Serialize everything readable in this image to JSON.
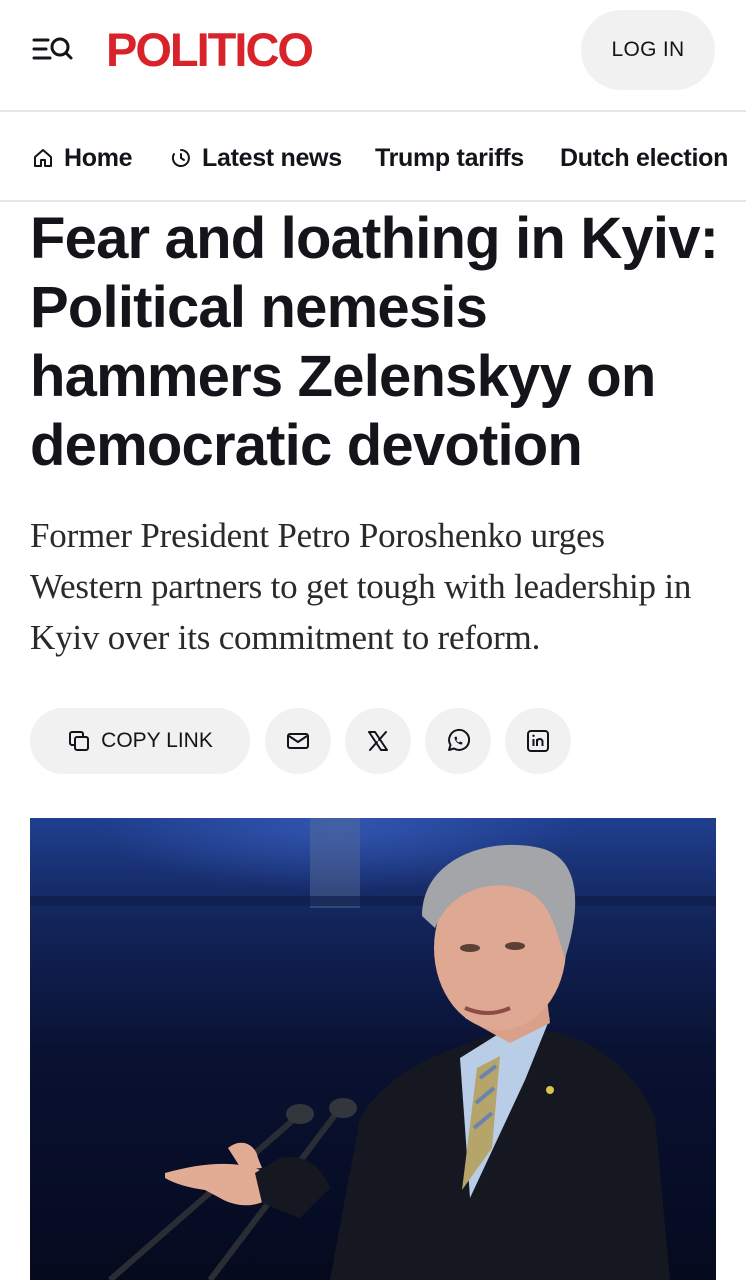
{
  "header": {
    "logo": "POLITICO",
    "login_label": "LOG IN",
    "brand_color": "#d8232a"
  },
  "nav": {
    "items": [
      {
        "label": "Home",
        "icon": "home-icon"
      },
      {
        "label": "Latest news",
        "icon": "clock-icon"
      },
      {
        "label": "Trump tariffs"
      },
      {
        "label": "Dutch election"
      }
    ]
  },
  "article": {
    "headline": "Fear and loathing in Kyiv: Political nemesis hammers Zelenskyy on democratic devotion",
    "dek": "Former President Petro Poroshenko urges Western partners to get tough with leadership in Kyiv over its commitment to reform."
  },
  "share": {
    "copy_label": "COPY LINK",
    "buttons": [
      "email-icon",
      "x-icon",
      "whatsapp-icon",
      "linkedin-icon"
    ]
  }
}
